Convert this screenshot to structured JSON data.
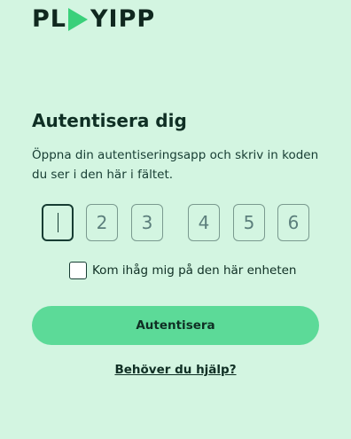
{
  "logo": {
    "left": "PL",
    "right": "YIPP",
    "play_icon": "play-icon"
  },
  "title": "Autentisera dig",
  "subtitle": "Öppna din autentiseringsapp och skriv in koden du ser i den här i fältet.",
  "otp": {
    "digits": [
      "",
      "2",
      "3",
      "4",
      "5",
      "6"
    ]
  },
  "remember": {
    "label": "Kom ihåg mig på den här enheten",
    "checked": false
  },
  "submit_label": "Autentisera",
  "help_label": "Behöver du hjälp?",
  "colors": {
    "background": "#d3f5e1",
    "accent": "#5cda98",
    "text": "#0f2f24"
  }
}
